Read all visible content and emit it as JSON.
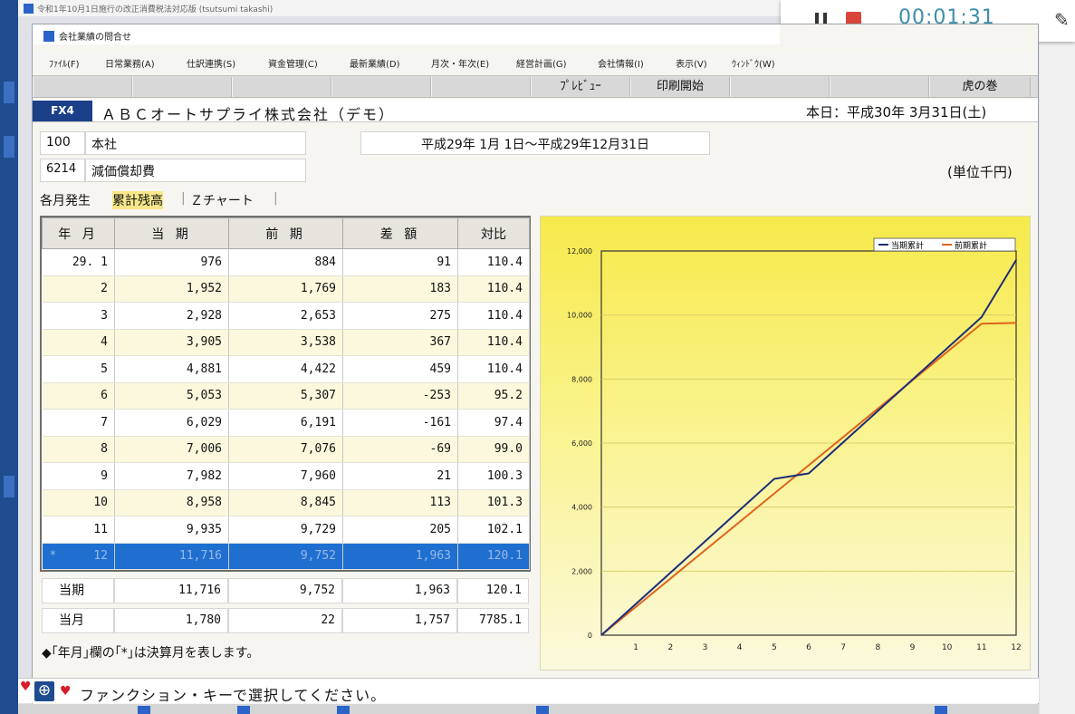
{
  "outer_window": {
    "title": "令和1年10月1日施行の改正消費税法対応版 (tsutsumi takashi)"
  },
  "recorder": {
    "time": "00:01:31",
    "pause_icon": "pause-icon",
    "stop_icon": "stop-icon",
    "pen_icon": "pen-icon"
  },
  "window": {
    "title": "会社業績の問合せ"
  },
  "menu": [
    "ﾌｧｲﾙ(F)",
    "日常業務(A)",
    "仕訳連携(S)",
    "資金管理(C)",
    "最新業績(D)",
    "月次・年次(E)",
    "経営計画(G)",
    "会社情報(I)",
    "表示(V)",
    "ｳｨﾝﾄﾞｳ(W)"
  ],
  "fkeys": {
    "preview": "ﾌﾟﾚﾋﾞｭｰ",
    "print": "印刷開始",
    "tora": "虎の巻"
  },
  "header": {
    "badge": "FX4",
    "company": "ＡＢＣオートサプライ株式会社（デモ）",
    "today": "本日：平成30年 3月31日(土)"
  },
  "filters": {
    "dept_code": "100",
    "dept_name": "本社",
    "account_code": "6214",
    "account_name": "減価償却費",
    "period": "平成29年 1月 1日～平成29年12月31日",
    "unit": "(単位千円)"
  },
  "tabs": [
    "各月発生",
    "累計残高",
    "Ｚチャート"
  ],
  "table": {
    "headers": [
      "年 月",
      "当 期",
      "前 期",
      "差 額",
      "対比"
    ],
    "rows": [
      {
        "month": "29. 1",
        "current": "976",
        "prior": "884",
        "diff": "91",
        "ratio": "110.4"
      },
      {
        "month": "2",
        "current": "1,952",
        "prior": "1,769",
        "diff": "183",
        "ratio": "110.4"
      },
      {
        "month": "3",
        "current": "2,928",
        "prior": "2,653",
        "diff": "275",
        "ratio": "110.4"
      },
      {
        "month": "4",
        "current": "3,905",
        "prior": "3,538",
        "diff": "367",
        "ratio": "110.4"
      },
      {
        "month": "5",
        "current": "4,881",
        "prior": "4,422",
        "diff": "459",
        "ratio": "110.4"
      },
      {
        "month": "6",
        "current": "5,053",
        "prior": "5,307",
        "diff": "-253",
        "ratio": "95.2"
      },
      {
        "month": "7",
        "current": "6,029",
        "prior": "6,191",
        "diff": "-161",
        "ratio": "97.4"
      },
      {
        "month": "8",
        "current": "7,006",
        "prior": "7,076",
        "diff": "-69",
        "ratio": "99.0"
      },
      {
        "month": "9",
        "current": "7,982",
        "prior": "7,960",
        "diff": "21",
        "ratio": "100.3"
      },
      {
        "month": "10",
        "current": "8,958",
        "prior": "8,845",
        "diff": "113",
        "ratio": "101.3"
      },
      {
        "month": "11",
        "current": "9,935",
        "prior": "9,729",
        "diff": "205",
        "ratio": "102.1"
      },
      {
        "month": "12",
        "mark": "*",
        "current": "11,716",
        "prior": "9,752",
        "diff": "1,963",
        "ratio": "120.1"
      }
    ],
    "summary": [
      {
        "label": "当期",
        "current": "11,716",
        "prior": "9,752",
        "diff": "1,963",
        "ratio": "120.1"
      },
      {
        "label": "当月",
        "current": "1,780",
        "prior": "22",
        "diff": "1,757",
        "ratio": "7785.1"
      }
    ]
  },
  "note": "◆｢年月｣欄の｢*｣は決算月を表します。",
  "status": {
    "text": "ファンクション・キーで選択してください。"
  },
  "colors": {
    "current_series": "#1c2e7a",
    "prior_series": "#e0621c",
    "selected_row": "#1f6fd1",
    "chart_top": "#f6e94a"
  },
  "chart_data": {
    "type": "line",
    "categories": [
      "1",
      "2",
      "3",
      "4",
      "5",
      "6",
      "7",
      "8",
      "9",
      "10",
      "11",
      "12"
    ],
    "ylim": [
      0,
      12000
    ],
    "yticks": [
      "0",
      "2,000",
      "4,000",
      "6,000",
      "8,000",
      "10,000",
      "12,000"
    ],
    "series": [
      {
        "name": "当期累計",
        "values": [
          976,
          1952,
          2928,
          3905,
          4881,
          5053,
          6029,
          7006,
          7982,
          8958,
          9935,
          11716
        ]
      },
      {
        "name": "前期累計",
        "values": [
          884,
          1769,
          2653,
          3538,
          4422,
          5307,
          6191,
          7076,
          7960,
          8845,
          9729,
          9752
        ]
      }
    ],
    "legend": "top-right",
    "grid": true
  }
}
